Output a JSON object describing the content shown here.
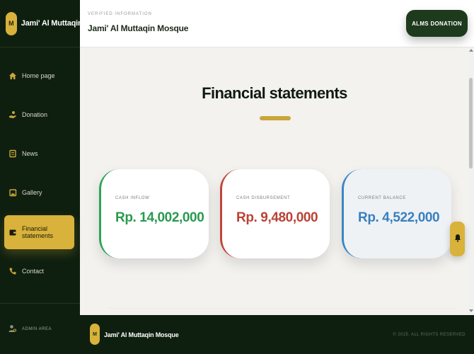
{
  "sidebar": {
    "brand_initial": "M",
    "brand_name": "Jami' Al Muttaqin...",
    "items": [
      {
        "label": "Home page",
        "icon": "home-icon"
      },
      {
        "label": "Donation",
        "icon": "donation-hand-icon"
      },
      {
        "label": "News",
        "icon": "news-icon"
      },
      {
        "label": "Gallery",
        "icon": "gallery-icon"
      },
      {
        "label": "Financial statements",
        "icon": "wallet-icon",
        "active": true
      },
      {
        "label": "Contact",
        "icon": "phone-icon"
      }
    ],
    "admin_label": "ADMIN AREA"
  },
  "header": {
    "verified_label": "VERIFIED INFORMATION",
    "title": "Jami' Al Muttaqin Mosque",
    "donate_button": "ALMS DONATION"
  },
  "main": {
    "section_title": "Financial statements",
    "cards": [
      {
        "label": "CASH INFLOW",
        "value": "Rp. 14,002,000",
        "color": "#2a9a4e"
      },
      {
        "label": "CASH DISBURSEMENT",
        "value": "Rp. 9,480,000",
        "color": "#b94335"
      },
      {
        "label": "CURRENT BALANCE",
        "value": "Rp. 4,522,000",
        "color": "#3a7fbf"
      }
    ]
  },
  "footer": {
    "initial": "M",
    "name": "Jami' Al Muttaqin Mosque",
    "copyright": "© 2025. ALL RIGHTS RESERVED"
  },
  "colors": {
    "sidebar_bg": "#0f1f0f",
    "accent_gold": "#d8b23a",
    "button_green": "#1d3a1d"
  }
}
